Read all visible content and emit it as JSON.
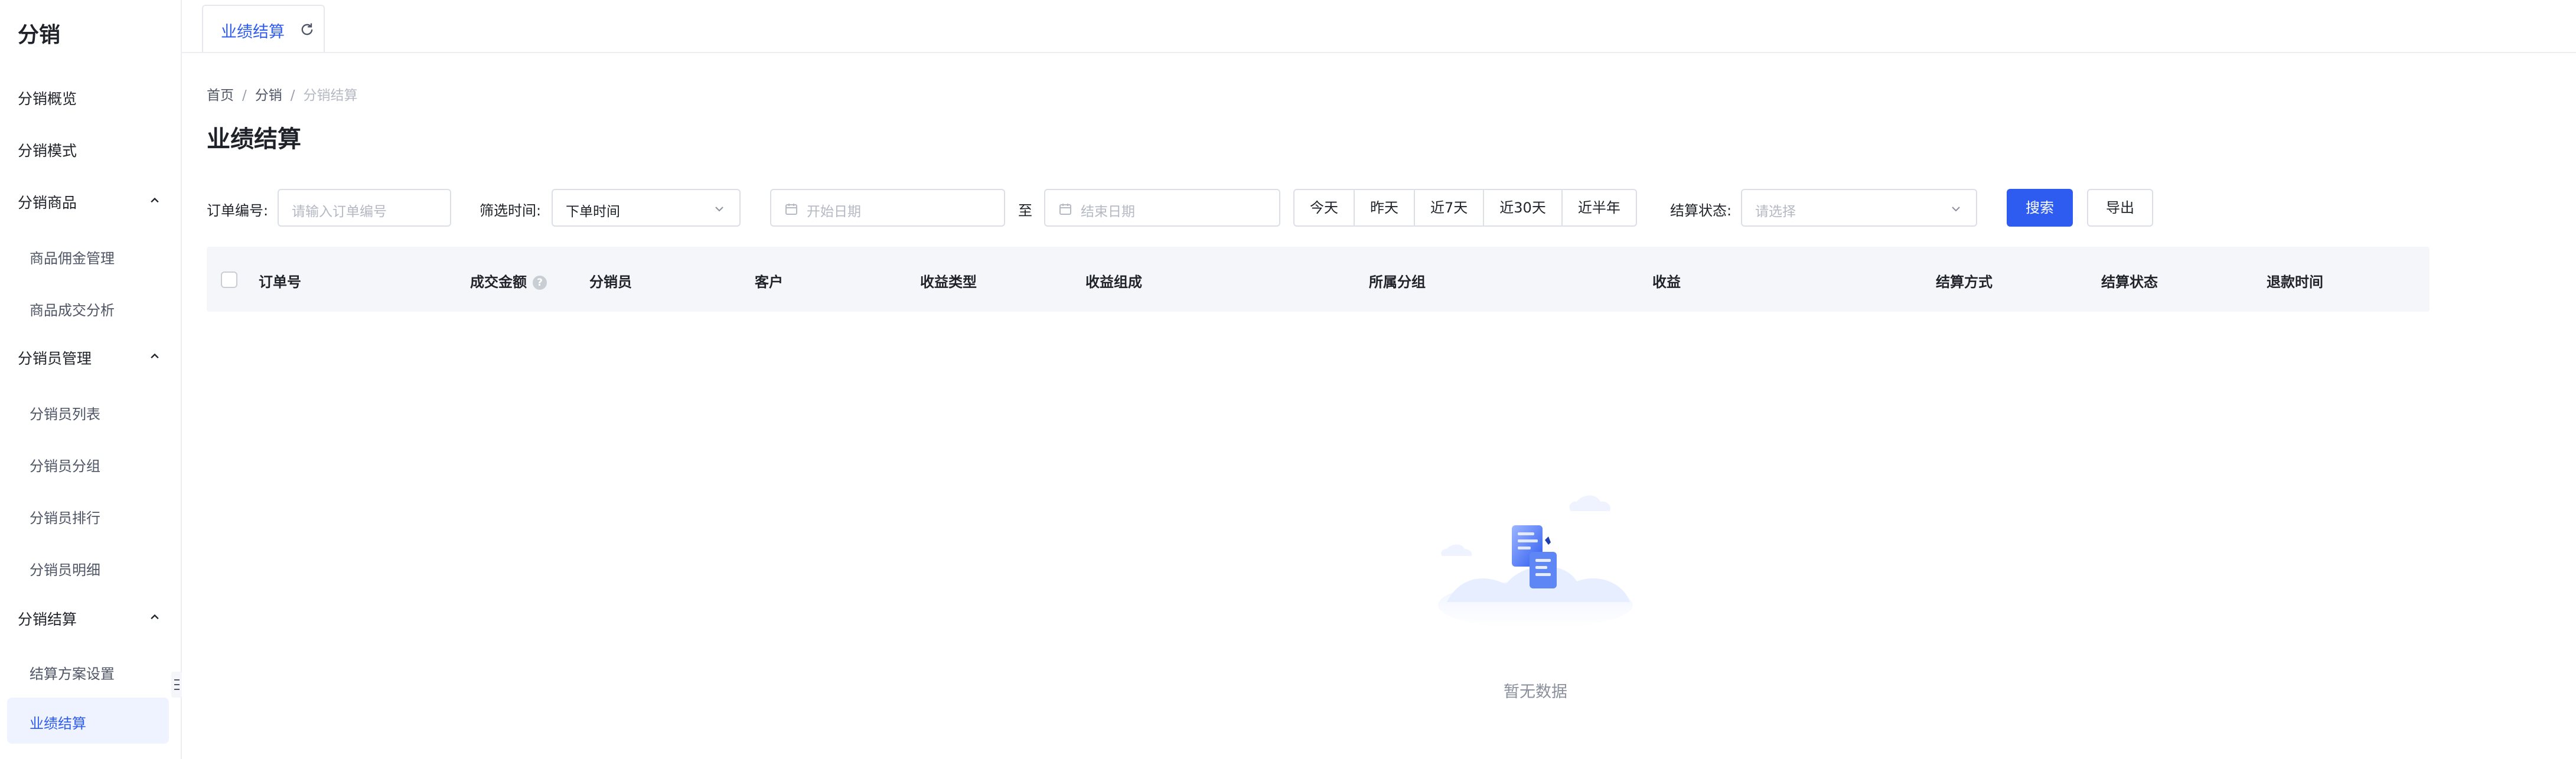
{
  "sidebar": {
    "title": "分销",
    "items": [
      {
        "label": "分销概览"
      },
      {
        "label": "分销模式"
      }
    ],
    "groups": [
      {
        "label": "分销商品",
        "children": [
          {
            "label": "商品佣金管理"
          },
          {
            "label": "商品成交分析"
          }
        ]
      },
      {
        "label": "分销员管理",
        "children": [
          {
            "label": "分销员列表"
          },
          {
            "label": "分销员分组"
          },
          {
            "label": "分销员排行"
          },
          {
            "label": "分销员明细"
          }
        ]
      },
      {
        "label": "分销结算",
        "children": [
          {
            "label": "结算方案设置"
          },
          {
            "label": "业绩结算"
          }
        ]
      }
    ],
    "active_color": "#2f5cf0"
  },
  "tabs": [
    {
      "label": "业绩结算"
    }
  ],
  "breadcrumb": [
    "首页",
    "分销",
    "分销结算"
  ],
  "breadcrumb_sep": "/",
  "page_title": "业绩结算",
  "filters": {
    "order_no_label": "订单编号:",
    "order_no_placeholder": "请输入订单编号",
    "time_label": "筛选时间:",
    "time_value": "下单时间",
    "start_placeholder": "开始日期",
    "to_label": "至",
    "end_placeholder": "结束日期",
    "quick_ranges": [
      "今天",
      "昨天",
      "近7天",
      "近30天",
      "近半年"
    ],
    "status_label": "结算状态:",
    "status_placeholder": "请选择",
    "search_label": "搜索",
    "export_label": "导出"
  },
  "table": {
    "columns": [
      "订单号",
      "成交金额",
      "分销员",
      "客户",
      "收益类型",
      "收益组成",
      "所属分组",
      "收益",
      "结算方式",
      "结算状态",
      "退款时间"
    ],
    "help_icon": "?",
    "empty_text": "暂无数据"
  },
  "colors": {
    "primary": "#2f5cf0",
    "header_bg": "#f4f6fa"
  }
}
